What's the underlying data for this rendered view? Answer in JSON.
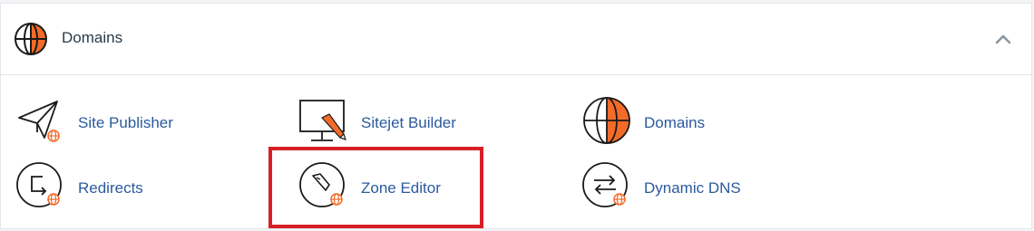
{
  "header": {
    "title": "Domains",
    "icon": "globe-icon",
    "collapse_icon": "chevron-up-icon"
  },
  "items": [
    {
      "label": "Site Publisher",
      "icon": "paper-plane-icon"
    },
    {
      "label": "Sitejet Builder",
      "icon": "monitor-pencil-icon"
    },
    {
      "label": "Domains",
      "icon": "globe-icon"
    },
    {
      "label": "Redirects",
      "icon": "redirect-icon"
    },
    {
      "label": "Zone Editor",
      "icon": "zone-editor-icon"
    },
    {
      "label": "Dynamic DNS",
      "icon": "dynamic-dns-icon"
    }
  ],
  "colors": {
    "accent": "#f26b29",
    "link": "#2a5a9e",
    "highlight": "#d81f26",
    "icon_stroke": "#1a1a1a"
  }
}
